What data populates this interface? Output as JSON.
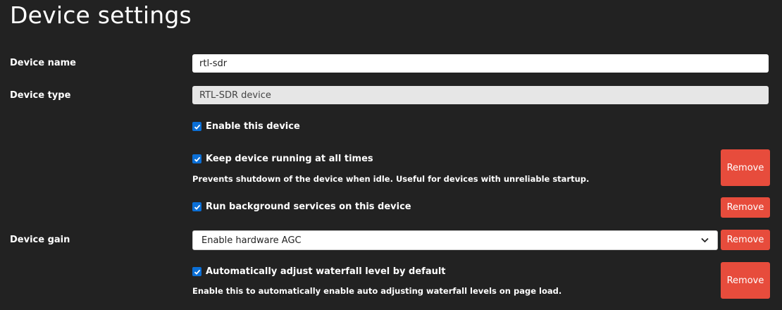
{
  "page": {
    "title": "Device settings"
  },
  "fields": {
    "device_name": {
      "label": "Device name",
      "value": "rtl-sdr"
    },
    "device_type": {
      "label": "Device type",
      "value": "RTL-SDR device"
    },
    "enable_device": {
      "label": "Enable this device",
      "checked": true
    },
    "keep_running": {
      "label": "Keep device running at all times",
      "checked": true,
      "help": "Prevents shutdown of the device when idle. Useful for devices with unreliable startup.",
      "remove_label": "Remove"
    },
    "background_services": {
      "label": "Run background services on this device",
      "checked": true,
      "remove_label": "Remove"
    },
    "device_gain": {
      "label": "Device gain",
      "selected": "Enable hardware AGC",
      "remove_label": "Remove"
    },
    "auto_waterfall": {
      "label": "Automatically adjust waterfall level by default",
      "checked": true,
      "help": "Enable this to automatically enable auto adjusting waterfall levels on page load.",
      "remove_label": "Remove"
    }
  },
  "colors": {
    "background": "#222222",
    "remove_button": "#e74c3c",
    "checkbox": "#0b6fd6"
  }
}
